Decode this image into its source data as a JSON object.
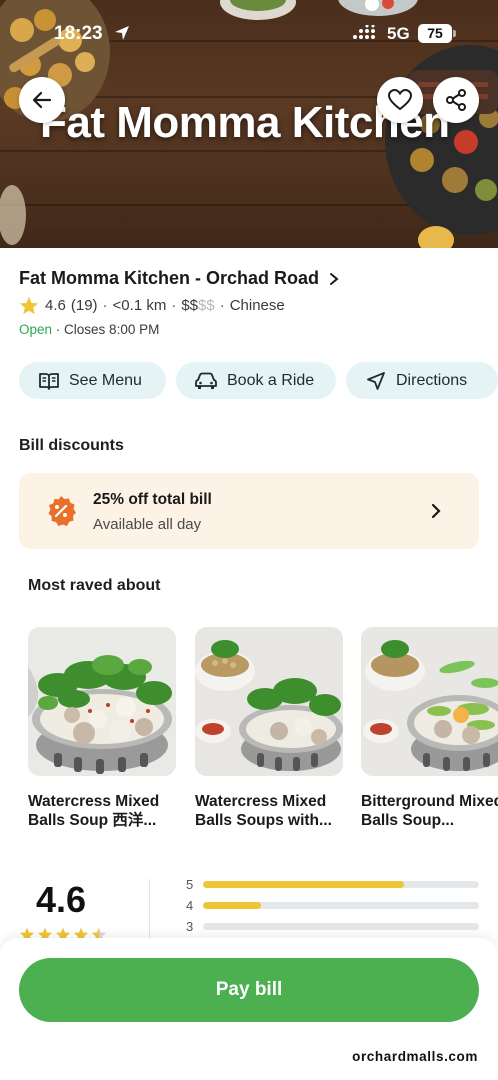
{
  "status_bar": {
    "time": "18:23",
    "network": "5G",
    "battery": "75"
  },
  "hero": {
    "title": "Fat Momma Kitchen"
  },
  "header_buttons": {
    "back": "back-arrow-icon",
    "favorite": "heart-icon",
    "share": "share-icon"
  },
  "store": {
    "name": "Fat Momma Kitchen - Orchad Road",
    "rating": "4.6",
    "review_count": "(19)",
    "distance": "<0.1 km",
    "price_active": "$$",
    "price_inactive": "$$",
    "cuisine": "Chinese",
    "status": "Open",
    "closes": "Closes 8:00 PM"
  },
  "actions": [
    {
      "label": "See Menu",
      "icon": "menu-book-icon"
    },
    {
      "label": "Book a Ride",
      "icon": "car-icon"
    },
    {
      "label": "Directions",
      "icon": "navigation-arrow-icon"
    }
  ],
  "bill_discounts": {
    "title": "Bill discounts",
    "offer_title": "25% off total bill",
    "offer_subtitle": "Available all day"
  },
  "most_raved": {
    "title": "Most raved about",
    "dishes": [
      {
        "name": "Watercress Mixed Balls Soup 西洋..."
      },
      {
        "name": "Watercress Mixed Balls Soups with..."
      },
      {
        "name": "Bitterground Mixed Balls Soup..."
      }
    ]
  },
  "ratings": {
    "average": "4.6",
    "stars": 4.5,
    "distribution": [
      {
        "star": "5",
        "fraction": 0.73
      },
      {
        "star": "4",
        "fraction": 0.21
      },
      {
        "star": "3",
        "fraction": 0.0
      }
    ]
  },
  "pay_button": {
    "label": "Pay bill"
  },
  "watermark": "orchardmalls.com",
  "colors": {
    "accent_green": "#4caf50",
    "open_green": "#2fa84f",
    "star_yellow": "#f0c535",
    "action_bg": "#e6f3f4",
    "discount_bg": "#fcf2e6",
    "discount_badge": "#e8702a"
  }
}
